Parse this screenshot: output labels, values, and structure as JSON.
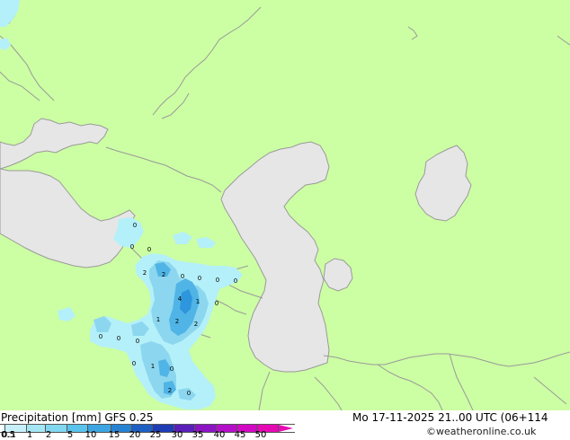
{
  "map": {
    "colors": {
      "land": "#ccfea3",
      "water": "#e6e6e6",
      "border": "#999999",
      "coast": "#9a9a9a",
      "precip_light": "#b4f0f9",
      "precip_mid": "#8cd7ef",
      "precip_heavy": "#50b4e6",
      "precip_max": "#2d96dc"
    },
    "labels": [
      {
        "id": "l1",
        "text": "0"
      },
      {
        "id": "l2",
        "text": "0"
      },
      {
        "id": "l3",
        "text": "0"
      },
      {
        "id": "l4",
        "text": "2"
      },
      {
        "id": "l5",
        "text": "2"
      },
      {
        "id": "l6",
        "text": "0"
      },
      {
        "id": "l7",
        "text": "0"
      },
      {
        "id": "l8",
        "text": "0"
      },
      {
        "id": "l9",
        "text": "0"
      },
      {
        "id": "l10",
        "text": "4"
      },
      {
        "id": "l11",
        "text": "1"
      },
      {
        "id": "l12",
        "text": "0"
      },
      {
        "id": "l13",
        "text": "1"
      },
      {
        "id": "l14",
        "text": "2"
      },
      {
        "id": "l15",
        "text": "2"
      },
      {
        "id": "l16",
        "text": "0"
      },
      {
        "id": "l17",
        "text": "0"
      },
      {
        "id": "l18",
        "text": "0"
      },
      {
        "id": "l19",
        "text": "0"
      },
      {
        "id": "l20",
        "text": "1"
      },
      {
        "id": "l21",
        "text": "0"
      },
      {
        "id": "l22",
        "text": "2"
      },
      {
        "id": "l23",
        "text": "0"
      }
    ]
  },
  "footer": {
    "title": "Precipitation [mm]  GFS 0.25",
    "datetime": "Mo 17-11-2025 21..00 UTC (06+114",
    "credit": "©weatheronline.co.uk"
  },
  "legend": {
    "ticks": [
      "0.1",
      "0.5",
      "1",
      "2",
      "5",
      "10",
      "15",
      "20",
      "25",
      "30",
      "35",
      "40",
      "45",
      "50"
    ],
    "colors": [
      "#e6faff",
      "#c8f0fa",
      "#a5e6f5",
      "#82d7f0",
      "#5ac3eb",
      "#3ca5e1",
      "#2882d2",
      "#1e5fc3",
      "#1e3cb4",
      "#5a1eb9",
      "#8c14c3",
      "#b40fc8",
      "#d20ac3",
      "#e60ab4"
    ]
  }
}
